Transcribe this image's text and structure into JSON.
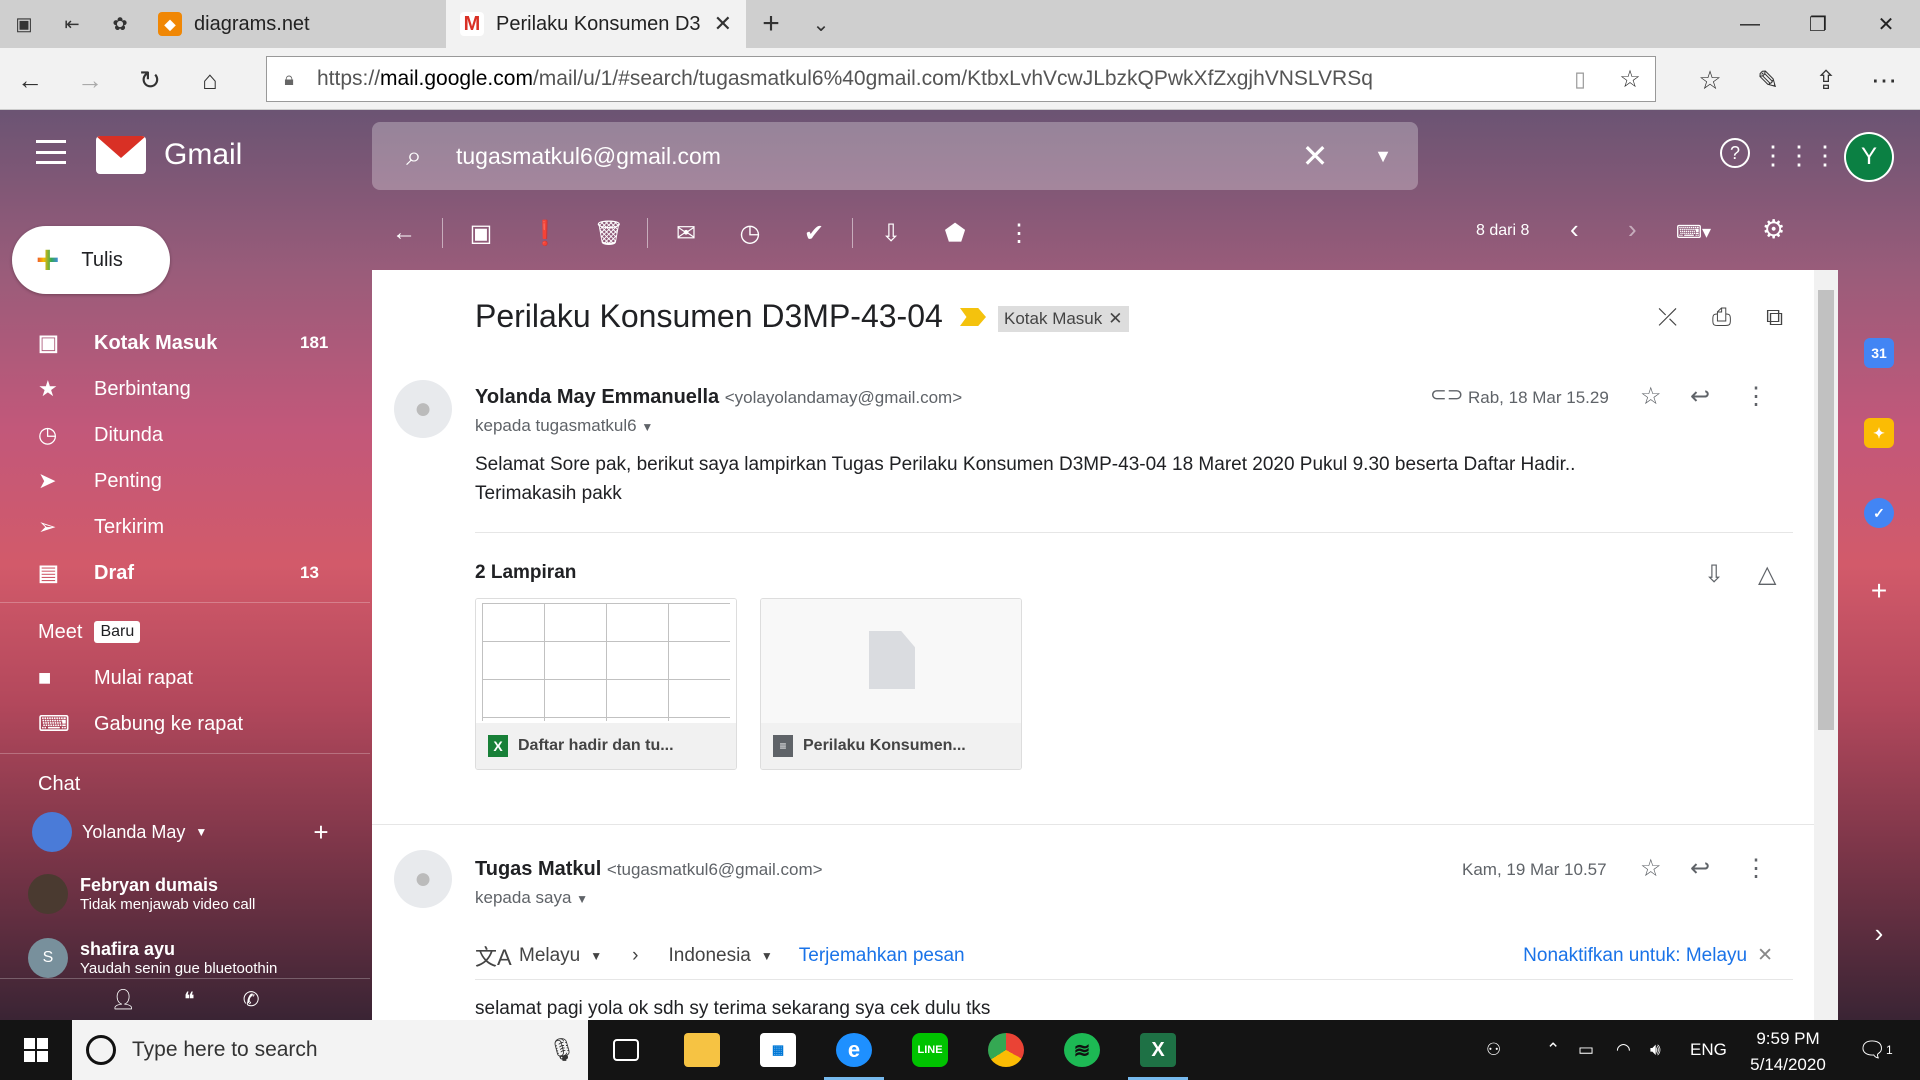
{
  "browser": {
    "tabs": [
      {
        "title": "diagrams.net",
        "active": false
      },
      {
        "title": "Perilaku Konsumen D3M",
        "active": true
      }
    ],
    "url_prefix": "https://",
    "url_host": "mail.google.com",
    "url_path": "/mail/u/1/#search/tugasmatkul6%40gmail.com/KtbxLvhVcwJLbzkQPwkXfZxgjhVNSLVRSq"
  },
  "gmail": {
    "logo_text": "Gmail",
    "search_query": "tugasmatkul6@gmail.com",
    "avatar_letter": "Y",
    "compose_label": "Tulis",
    "nav": [
      {
        "label": "Kotak Masuk",
        "count": "181",
        "icon": "inbox-icon",
        "bold": true
      },
      {
        "label": "Berbintang",
        "count": "",
        "icon": "star-icon",
        "bold": false
      },
      {
        "label": "Ditunda",
        "count": "",
        "icon": "clock-icon",
        "bold": false
      },
      {
        "label": "Penting",
        "count": "",
        "icon": "important-icon",
        "bold": false
      },
      {
        "label": "Terkirim",
        "count": "",
        "icon": "send-icon",
        "bold": false
      },
      {
        "label": "Draf",
        "count": "13",
        "icon": "draft-icon",
        "bold": true
      }
    ],
    "meet": {
      "title": "Meet",
      "badge": "Baru",
      "items": [
        {
          "label": "Mulai rapat",
          "icon": "video-icon"
        },
        {
          "label": "Gabung ke rapat",
          "icon": "keyboard-icon"
        }
      ]
    },
    "chat": {
      "title": "Chat",
      "me": "Yolanda May",
      "contacts": [
        {
          "name": "Febryan dumais",
          "status": "Tidak menjawab video call"
        },
        {
          "name": "shafira ayu",
          "status": "Yaudah senin gue bluetoothin",
          "initial": "S"
        }
      ]
    },
    "pager": "8 dari 8",
    "thread": {
      "subject": "Perilaku Konsumen D3MP-43-04",
      "label": "Kotak Masuk",
      "messages": [
        {
          "sender": "Yolanda May Emmanuella",
          "email": "<yolayolandamay@gmail.com>",
          "to": "kepada tugasmatkul6",
          "date": "Rab, 18 Mar 15.29",
          "body_line1": "Selamat Sore pak, berikut saya lampirkan Tugas Perilaku Konsumen D3MP-43-04 18 Maret 2020 Pukul 9.30 beserta Daftar Hadir..",
          "body_line2": "Terimakasih pakk",
          "attachments_title": "2 Lampiran",
          "attachments": [
            {
              "name": "Daftar hadir dan tu...",
              "type": "xlsx"
            },
            {
              "name": "Perilaku Konsumen...",
              "type": "doc"
            }
          ]
        },
        {
          "sender": "Tugas Matkul",
          "email": "<tugasmatkul6@gmail.com>",
          "to": "kepada saya",
          "date": "Kam, 19 Mar 10.57",
          "translate_from": "Melayu",
          "translate_to": "Indonesia",
          "translate_action": "Terjemahkan pesan",
          "translate_disable": "Nonaktifkan untuk: Melayu",
          "body_line1": "selamat pagi yola ok sdh sy terima sekarang sya cek dulu tks"
        }
      ]
    }
  },
  "taskbar": {
    "search_placeholder": "Type here to search",
    "lang": "ENG",
    "time": "9:59 PM",
    "date": "5/14/2020",
    "notif_count": "1"
  }
}
